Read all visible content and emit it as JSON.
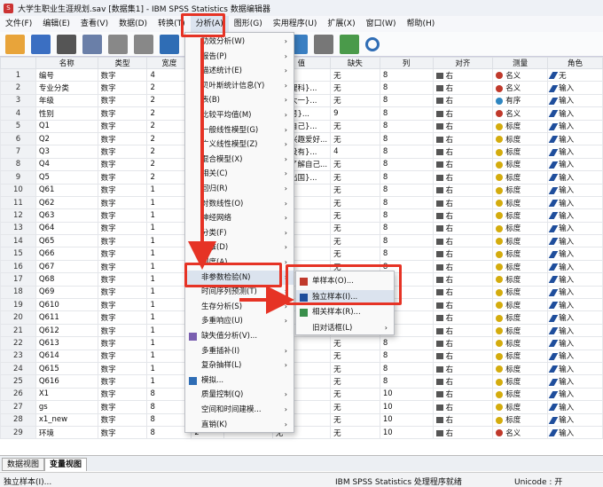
{
  "window": {
    "title": "大学生职业生涯规划.sav [数据集1] - IBM SPSS Statistics 数据编辑器"
  },
  "menubar": [
    "文件(F)",
    "编辑(E)",
    "查看(V)",
    "数据(D)",
    "转换(T)",
    "分析(A)",
    "图形(G)",
    "实用程序(U)",
    "扩展(X)",
    "窗口(W)",
    "帮助(H)"
  ],
  "toolbar": [
    "open-folder-icon",
    "save-icon",
    "print-icon",
    "dialog-recall-icon",
    "undo-icon",
    "redo-icon",
    "goto-case-icon",
    "goto-variable-icon",
    "split-file-icon",
    "select-cases-icon",
    "value-labels-icon",
    "use-sets-icon",
    "show-all-icon",
    "spellcheck-icon",
    "search-icon"
  ],
  "grid": {
    "columns": [
      "名称",
      "类型",
      "宽度",
      "",
      "",
      "值",
      "缺失",
      "列",
      "对齐",
      "测量",
      "角色"
    ],
    "rows": [
      [
        "1",
        "编号",
        "数字",
        "4",
        "",
        "",
        "无",
        "无",
        "8",
        "右",
        "名义",
        "无"
      ],
      [
        "2",
        "专业分类",
        "数字",
        "2",
        "",
        "",
        "{1, 理科}...",
        "无",
        "8",
        "右",
        "名义",
        "输入"
      ],
      [
        "3",
        "年级",
        "数字",
        "2",
        "",
        "",
        "{1, 大一}...",
        "无",
        "8",
        "右",
        "有序",
        "输入"
      ],
      [
        "4",
        "性别",
        "数字",
        "2",
        "",
        "",
        "{1, 男}...",
        "9",
        "8",
        "右",
        "名义",
        "输入"
      ],
      [
        "5",
        "Q1",
        "数字",
        "2",
        "",
        "",
        "{1, 自己}...",
        "无",
        "8",
        "右",
        "标度",
        "输入"
      ],
      [
        "6",
        "Q2",
        "数字",
        "2",
        "",
        "",
        "{1, 兴趣爱好...",
        "无",
        "8",
        "右",
        "标度",
        "输入"
      ],
      [
        "7",
        "Q3",
        "数字",
        "2",
        "",
        "",
        "{1, 没有}...",
        "4",
        "8",
        "右",
        "标度",
        "输入"
      ],
      [
        "8",
        "Q4",
        "数字",
        "2",
        "",
        "",
        "{1, 了解自己...",
        "无",
        "8",
        "右",
        "标度",
        "输入"
      ],
      [
        "9",
        "Q5",
        "数字",
        "2",
        "",
        "",
        "{1, 出国}...",
        "无",
        "8",
        "右",
        "标度",
        "输入"
      ],
      [
        "10",
        "Q61",
        "数字",
        "1",
        "",
        "",
        "无",
        "无",
        "8",
        "右",
        "标度",
        "输入"
      ],
      [
        "11",
        "Q62",
        "数字",
        "1",
        "",
        "",
        "无",
        "无",
        "8",
        "右",
        "标度",
        "输入"
      ],
      [
        "12",
        "Q63",
        "数字",
        "1",
        "",
        "",
        "无",
        "无",
        "8",
        "右",
        "标度",
        "输入"
      ],
      [
        "13",
        "Q64",
        "数字",
        "1",
        "",
        "",
        "无",
        "无",
        "8",
        "右",
        "标度",
        "输入"
      ],
      [
        "14",
        "Q65",
        "数字",
        "1",
        "",
        "",
        "无",
        "无",
        "8",
        "右",
        "标度",
        "输入"
      ],
      [
        "15",
        "Q66",
        "数字",
        "1",
        "",
        "",
        "无",
        "无",
        "8",
        "右",
        "标度",
        "输入"
      ],
      [
        "16",
        "Q67",
        "数字",
        "1",
        "",
        "",
        "无",
        "无",
        "8",
        "右",
        "标度",
        "输入"
      ],
      [
        "17",
        "Q68",
        "数字",
        "1",
        "",
        "",
        "无",
        "无",
        "8",
        "右",
        "标度",
        "输入"
      ],
      [
        "18",
        "Q69",
        "数字",
        "1",
        "",
        "",
        "无",
        "无",
        "8",
        "右",
        "标度",
        "输入"
      ],
      [
        "19",
        "Q610",
        "数字",
        "1",
        "",
        "",
        "无",
        "无",
        "8",
        "右",
        "标度",
        "输入"
      ],
      [
        "20",
        "Q611",
        "数字",
        "1",
        "",
        "",
        "无",
        "无",
        "8",
        "右",
        "标度",
        "输入"
      ],
      [
        "21",
        "Q612",
        "数字",
        "1",
        "",
        "",
        "无",
        "无",
        "8",
        "右",
        "标度",
        "输入"
      ],
      [
        "22",
        "Q613",
        "数字",
        "1",
        "",
        "",
        "无",
        "无",
        "8",
        "右",
        "标度",
        "输入"
      ],
      [
        "23",
        "Q614",
        "数字",
        "1",
        "",
        "",
        "无",
        "无",
        "8",
        "右",
        "标度",
        "输入"
      ],
      [
        "24",
        "Q615",
        "数字",
        "1",
        "",
        "",
        "无",
        "无",
        "8",
        "右",
        "标度",
        "输入"
      ],
      [
        "25",
        "Q616",
        "数字",
        "1",
        "",
        "",
        "无",
        "无",
        "8",
        "右",
        "标度",
        "输入"
      ],
      [
        "26",
        "X1",
        "数字",
        "8",
        "",
        "",
        "无",
        "无",
        "10",
        "右",
        "标度",
        "输入"
      ],
      [
        "27",
        "gs",
        "数字",
        "8",
        "",
        "",
        "无",
        "无",
        "10",
        "右",
        "标度",
        "输入"
      ],
      [
        "28",
        "x1_new",
        "数字",
        "8",
        "",
        "",
        "无",
        "无",
        "10",
        "右",
        "标度",
        "输入"
      ],
      [
        "29",
        "环境",
        "数字",
        "8",
        "2",
        "",
        "无",
        "无",
        "10",
        "右",
        "名义",
        "输入"
      ]
    ]
  },
  "analyze_menu": [
    {
      "label": "功效分析(W)",
      "arrow": true
    },
    {
      "label": "报告(P)",
      "arrow": true
    },
    {
      "label": "描述统计(E)",
      "arrow": true
    },
    {
      "label": "贝叶斯统计信息(Y)",
      "arrow": true
    },
    {
      "label": "表(B)",
      "arrow": true
    },
    {
      "label": "比较平均值(M)",
      "arrow": true
    },
    {
      "label": "一般线性模型(G)",
      "arrow": true
    },
    {
      "label": "广义线性模型(Z)",
      "arrow": true
    },
    {
      "label": "混合模型(X)",
      "arrow": true
    },
    {
      "label": "相关(C)",
      "arrow": true
    },
    {
      "label": "回归(R)",
      "arrow": true
    },
    {
      "label": "对数线性(O)",
      "arrow": true
    },
    {
      "label": "神经网络",
      "arrow": true
    },
    {
      "label": "分类(F)",
      "arrow": true
    },
    {
      "label": "降维(D)",
      "arrow": true
    },
    {
      "label": "刻度(A)",
      "arrow": true
    },
    {
      "label": "非参数检验(N)",
      "arrow": true
    },
    {
      "label": "时间序列预测(T)",
      "arrow": true
    },
    {
      "label": "生存分析(S)",
      "arrow": true
    },
    {
      "label": "多重响应(U)",
      "arrow": true
    },
    {
      "label": "缺失值分析(V)...",
      "arrow": false,
      "icon": true
    },
    {
      "label": "多重插补(I)",
      "arrow": true
    },
    {
      "label": "复杂抽样(L)",
      "arrow": true
    },
    {
      "label": "模拟...",
      "arrow": false,
      "icon": true
    },
    {
      "label": "质量控制(Q)",
      "arrow": true
    },
    {
      "label": "空间和时间建模...",
      "arrow": true
    },
    {
      "label": "直销(K)",
      "arrow": true
    }
  ],
  "nonparam_menu": [
    {
      "label": "单样本(O)...",
      "icon": "one-sample-icon"
    },
    {
      "label": "独立样本(I)...",
      "icon": "independent-samples-icon"
    },
    {
      "label": "相关样本(R)...",
      "icon": "related-samples-icon"
    },
    {
      "label": "旧对话框(L)",
      "icon": ""
    }
  ],
  "tabs": [
    "数据视图",
    "变量视图"
  ],
  "status": {
    "left": "独立样本(I)...",
    "processor": "IBM SPSS Statistics 处理程序就绪",
    "unicode": "Unicode : 开"
  },
  "colors": {
    "highlight": "#e63325",
    "arrow": "#e63325"
  }
}
